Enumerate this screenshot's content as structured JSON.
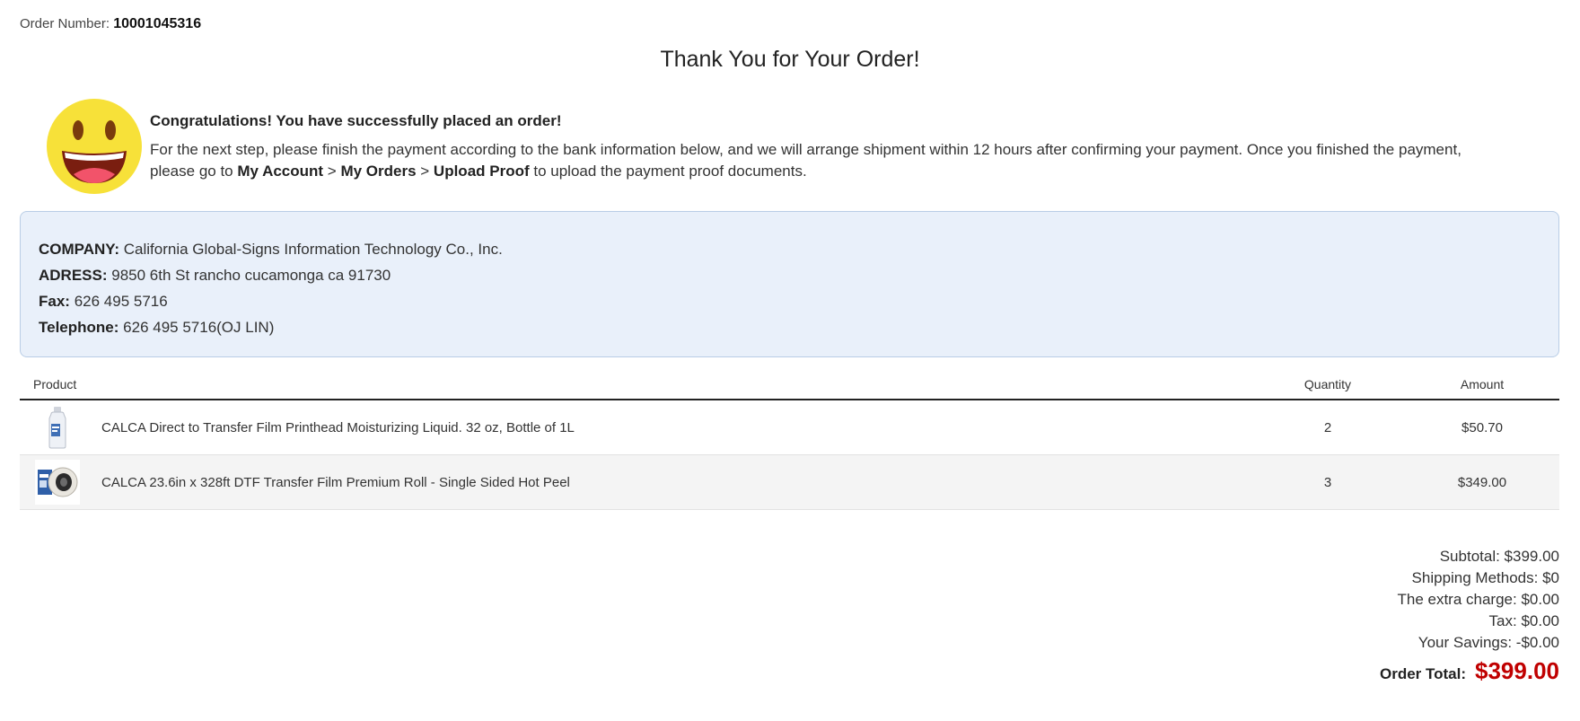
{
  "order": {
    "number_label": "Order Number:",
    "number": "10001045316"
  },
  "title": "Thank You for Your Order!",
  "message": {
    "heading": "Congratulations! You have successfully placed an order!",
    "text_1": "For the next step, please finish the payment according to the bank information below, and we will arrange shipment within 12 hours after confirming your payment. Once you finished the payment, please go to ",
    "link_account": "My Account",
    "sep_1": " > ",
    "link_orders": "My Orders",
    "sep_2": " > ",
    "link_upload": "Upload Proof",
    "text_2": " to upload the payment proof documents."
  },
  "bank": {
    "company_label": "COMPANY:",
    "company": "California Global-Signs Information Technology Co., Inc.",
    "address_label": "ADRESS:",
    "address": "9850 6th St rancho cucamonga ca 91730",
    "fax_label": "Fax:",
    "fax": "626 495 5716",
    "telephone_label": "Telephone:",
    "telephone": "626 495 5716(OJ LIN)"
  },
  "table": {
    "headers": {
      "product": "Product",
      "quantity": "Quantity",
      "amount": "Amount"
    },
    "rows": [
      {
        "name": "CALCA Direct to Transfer Film Printhead Moisturizing Liquid. 32 oz, Bottle of 1L",
        "quantity": "2",
        "amount": "$50.70",
        "icon": "bottle-icon"
      },
      {
        "name": "CALCA 23.6in x 328ft DTF Transfer Film Premium Roll - Single Sided Hot Peel",
        "quantity": "3",
        "amount": "$349.00",
        "icon": "film-roll-icon"
      }
    ]
  },
  "totals": {
    "subtotal": "Subtotal: $399.00",
    "shipping": "Shipping Methods: $0",
    "extra": "The extra charge: $0.00",
    "tax": "Tax: $0.00",
    "savings": "Your Savings: -$0.00",
    "order_total_label": "Order Total:",
    "order_total": "$399.00"
  },
  "colors": {
    "accent_total": "#c00000",
    "bank_bg": "#e9f0fa",
    "smiley": "#f7e139"
  }
}
